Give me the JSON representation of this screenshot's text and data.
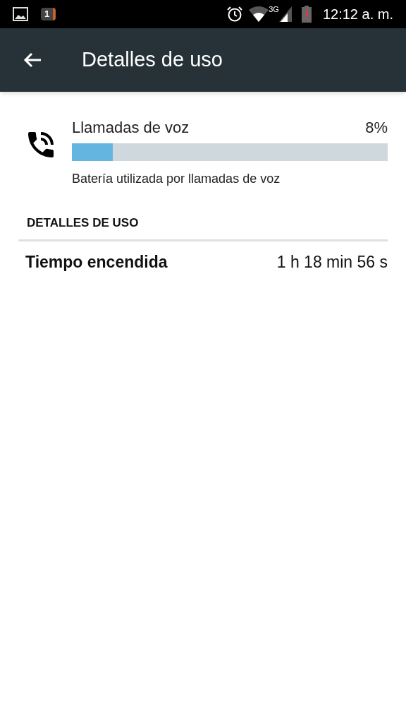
{
  "status_bar": {
    "notification_count": "1",
    "network": "3G",
    "time": "12:12 a. m."
  },
  "app_bar": {
    "title": "Detalles de uso"
  },
  "usage": {
    "title": "Llamadas de voz",
    "percent": "8%",
    "level": 0.13,
    "summary": "Batería utilizada por llamadas de voz"
  },
  "section": {
    "header": "DETALLES DE USO",
    "rows": [
      {
        "label": "Tiempo encendida",
        "value": "1 h 18 min 56 s"
      }
    ]
  }
}
